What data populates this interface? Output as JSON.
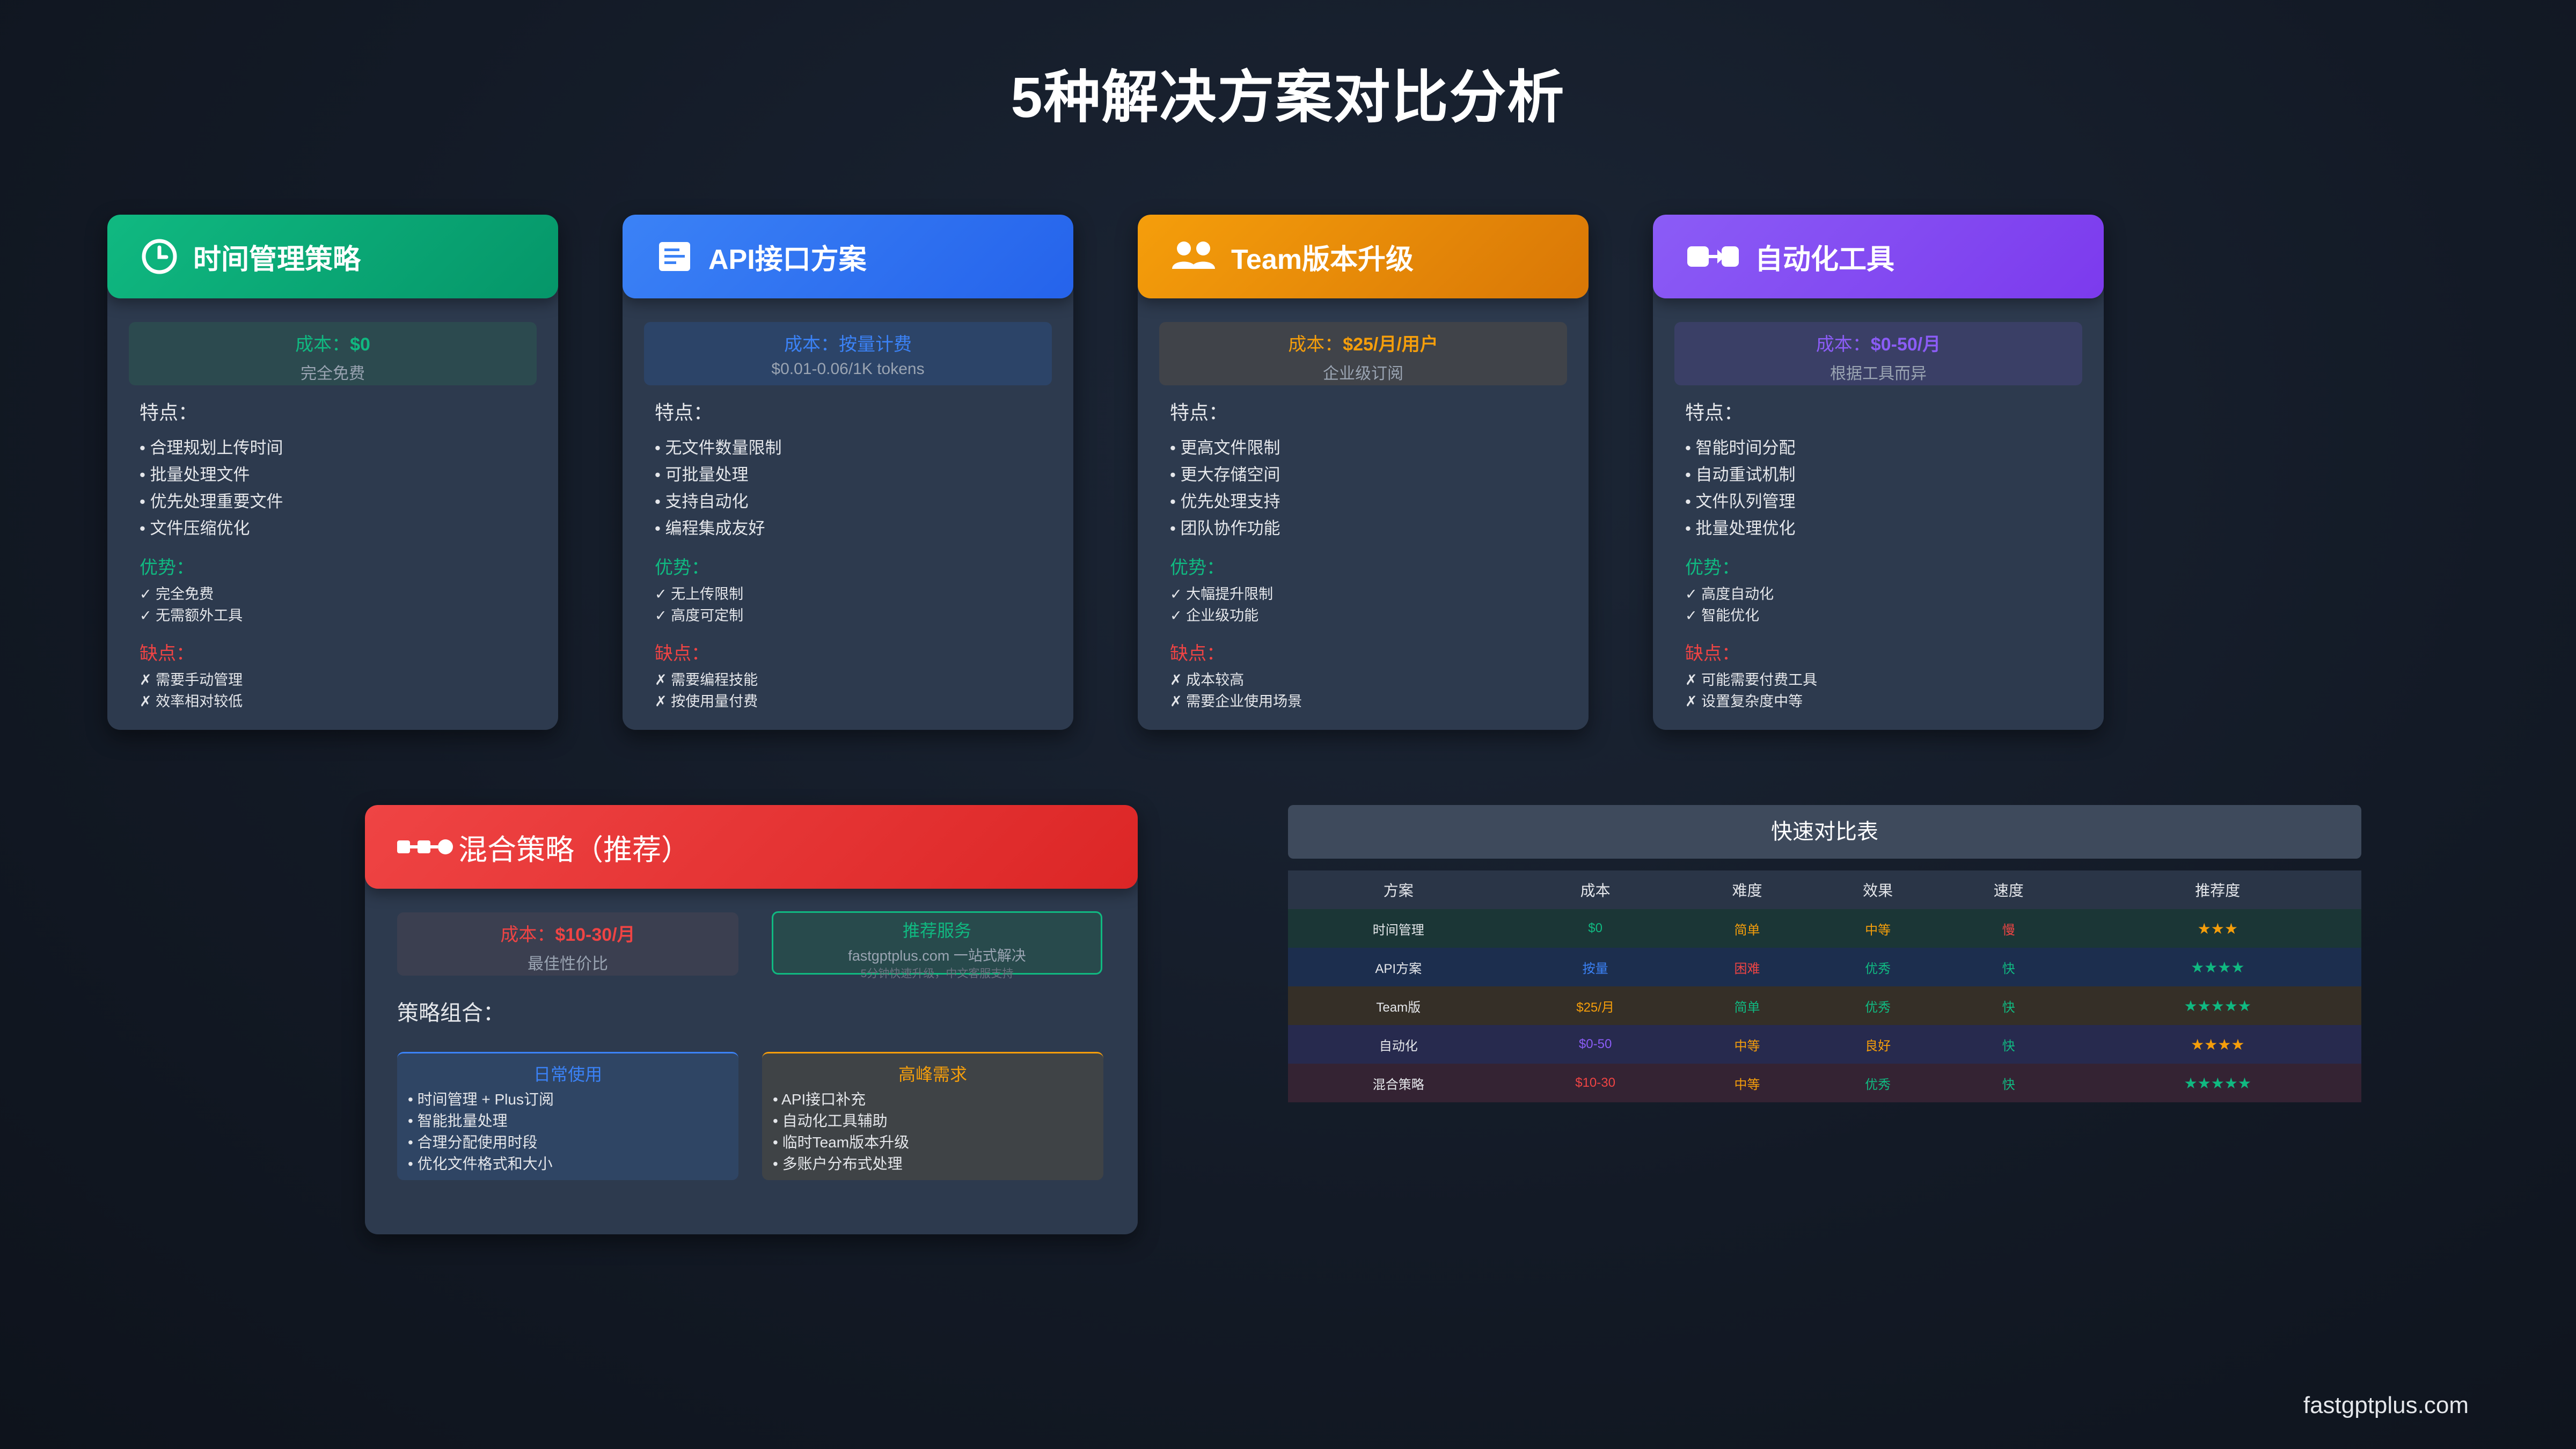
{
  "page": {
    "title": "5种解决方案对比分析",
    "footer": "fastgptplus.com"
  },
  "colors": {
    "green": "#10b981",
    "blue": "#3b82f6",
    "orange": "#f59e0b",
    "purple": "#8b5cf6",
    "red": "#ef4444"
  },
  "cards": [
    {
      "title": "时间管理策略",
      "icon": "clock-icon",
      "cost_label": "成本：",
      "cost_value": "$0",
      "cost_sub": "完全免费",
      "features_title": "特点：",
      "features": [
        "合理规划上传时间",
        "批量处理文件",
        "优先处理重要文件",
        "文件压缩优化"
      ],
      "pros_title": "优势：",
      "pros": [
        "✓ 完全免费",
        "✓ 无需额外工具"
      ],
      "cons_title": "缺点：",
      "cons": [
        "✗ 需要手动管理",
        "✗ 效率相对较低"
      ]
    },
    {
      "title": "API接口方案",
      "icon": "document-icon",
      "cost_label": "成本：",
      "cost_value": "按量计费",
      "cost_sub": "$0.01-0.06/1K tokens",
      "features_title": "特点：",
      "features": [
        "无文件数量限制",
        "可批量处理",
        "支持自动化",
        "编程集成友好"
      ],
      "pros_title": "优势：",
      "pros": [
        "✓ 无上传限制",
        "✓ 高度可定制"
      ],
      "cons_title": "缺点：",
      "cons": [
        "✗ 需要编程技能",
        "✗ 按使用量付费"
      ]
    },
    {
      "title": "Team版本升级",
      "icon": "users-icon",
      "cost_label": "成本：",
      "cost_value": "$25/月/用户",
      "cost_sub": "企业级订阅",
      "features_title": "特点：",
      "features": [
        "更高文件限制",
        "更大存储空间",
        "优先处理支持",
        "团队协作功能"
      ],
      "pros_title": "优势：",
      "pros": [
        "✓ 大幅提升限制",
        "✓ 企业级功能"
      ],
      "cons_title": "缺点：",
      "cons": [
        "✗ 成本较高",
        "✗ 需要企业使用场景"
      ]
    },
    {
      "title": "自动化工具",
      "icon": "automation-icon",
      "cost_label": "成本：",
      "cost_value": "$0-50/月",
      "cost_sub": "根据工具而异",
      "features_title": "特点：",
      "features": [
        "智能时间分配",
        "自动重试机制",
        "文件队列管理",
        "批量处理优化"
      ],
      "pros_title": "优势：",
      "pros": [
        "✓ 高度自动化",
        "✓ 智能优化"
      ],
      "cons_title": "缺点：",
      "cons": [
        "✗ 可能需要付费工具",
        "✗ 设置复杂度中等"
      ]
    }
  ],
  "mixed": {
    "title": "混合策略（推荐）",
    "icon": "nodes-icon",
    "cost_label": "成本：",
    "cost_value": "$10-30/月",
    "cost_sub": "最佳性价比",
    "recommend_title": "推荐服务",
    "recommend_line1": "fastgptplus.com 一站式解决",
    "recommend_line2": "5分钟快速升级，中文客服支持",
    "combo_title": "策略组合：",
    "daily_title": "日常使用",
    "daily": [
      "时间管理 + Plus订阅",
      "智能批量处理",
      "合理分配使用时段",
      "优化文件格式和大小"
    ],
    "peak_title": "高峰需求",
    "peak": [
      "API接口补充",
      "自动化工具辅助",
      "临时Team版本升级",
      "多账户分布式处理"
    ]
  },
  "table": {
    "title": "快速对比表",
    "headers": [
      "方案",
      "成本",
      "难度",
      "效果",
      "速度",
      "推荐度"
    ],
    "rows": [
      [
        "时间管理",
        "$0",
        "简单",
        "中等",
        "慢",
        "★★★"
      ],
      [
        "API方案",
        "按量",
        "困难",
        "优秀",
        "快",
        "★★★★"
      ],
      [
        "Team版",
        "$25/月",
        "简单",
        "优秀",
        "快",
        "★★★★★"
      ],
      [
        "自动化",
        "$0-50",
        "中等",
        "良好",
        "快",
        "★★★★"
      ],
      [
        "混合策略",
        "$10-30",
        "中等",
        "优秀",
        "快",
        "★★★★★"
      ]
    ]
  }
}
